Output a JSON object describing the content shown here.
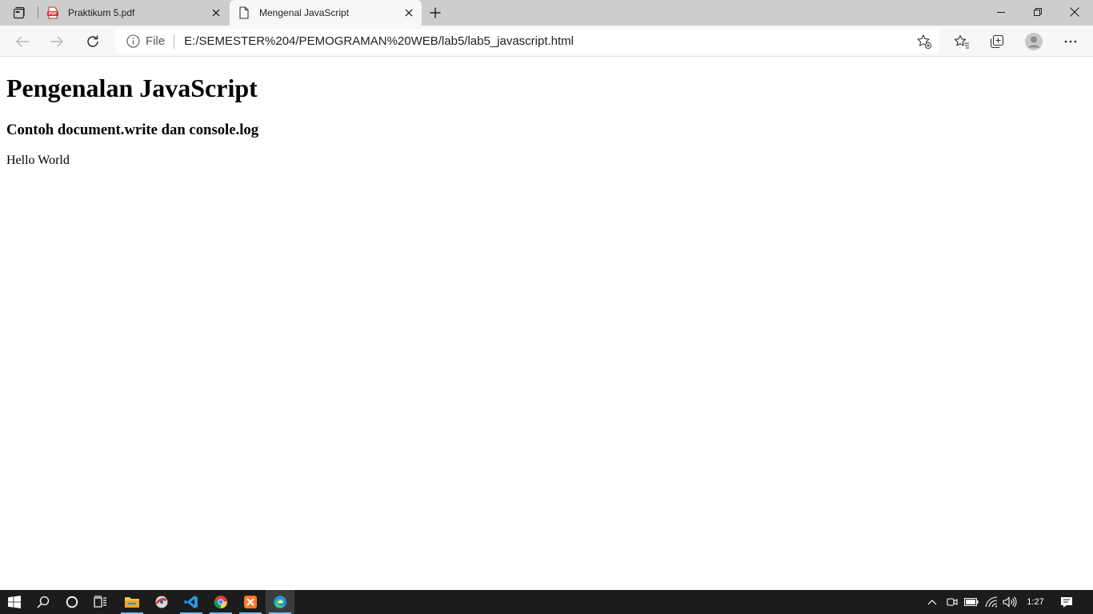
{
  "browser": {
    "tabs": [
      {
        "title": "Praktikum 5.pdf",
        "icon": "pdf-icon",
        "active": false
      },
      {
        "title": "Mengenal JavaScript",
        "icon": "page-icon",
        "active": true
      }
    ],
    "address": {
      "scheme_label": "File",
      "url": "E:/SEMESTER%204/PEMOGRAMAN%20WEB/lab5/lab5_javascript.html"
    },
    "toolbar_icons": [
      "back-icon",
      "forward-icon",
      "refresh-icon",
      "info-icon",
      "add-favorite-icon",
      "favorites-icon",
      "collections-icon",
      "profile-icon",
      "more-icon"
    ],
    "window_controls": [
      "minimize-icon",
      "restore-icon",
      "close-icon"
    ]
  },
  "page": {
    "heading": "Pengenalan JavaScript",
    "subheading": "Contoh document.write dan console.log",
    "output_text": "Hello World"
  },
  "taskbar": {
    "apps": [
      "windows-start-icon",
      "search-icon",
      "cortana-icon",
      "task-view-icon",
      "file-explorer-icon",
      "app-icon",
      "vscode-icon",
      "chrome-icon",
      "xampp-icon",
      "edge-icon"
    ],
    "tray_icons": [
      "show-hidden-icons-icon",
      "meet-now-icon",
      "battery-icon",
      "wifi-icon",
      "volume-icon",
      "notifications-icon"
    ],
    "clock": "1:27"
  },
  "colors": {
    "tabstrip": "#cdcdcd",
    "toolbar": "#f7f7f7",
    "taskbar": "#1c1c1c",
    "running_indicator": "#76b9ed"
  }
}
